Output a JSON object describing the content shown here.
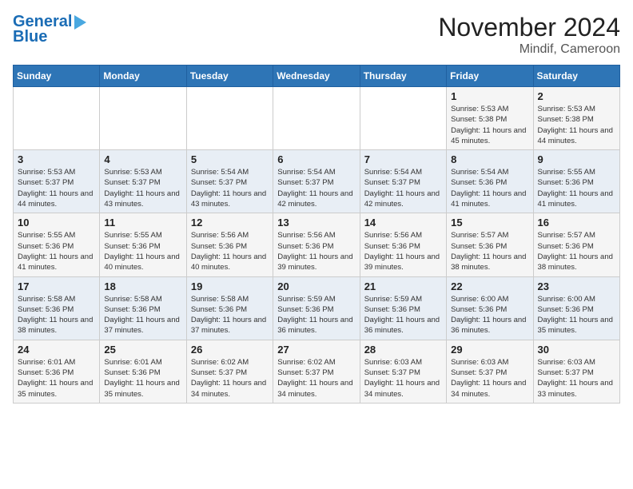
{
  "header": {
    "logo_line1": "General",
    "logo_line2": "Blue",
    "title": "November 2024",
    "subtitle": "Mindif, Cameroon"
  },
  "calendar": {
    "weekdays": [
      "Sunday",
      "Monday",
      "Tuesday",
      "Wednesday",
      "Thursday",
      "Friday",
      "Saturday"
    ],
    "weeks": [
      [
        {
          "day": "",
          "info": ""
        },
        {
          "day": "",
          "info": ""
        },
        {
          "day": "",
          "info": ""
        },
        {
          "day": "",
          "info": ""
        },
        {
          "day": "",
          "info": ""
        },
        {
          "day": "1",
          "info": "Sunrise: 5:53 AM\nSunset: 5:38 PM\nDaylight: 11 hours and 45 minutes."
        },
        {
          "day": "2",
          "info": "Sunrise: 5:53 AM\nSunset: 5:38 PM\nDaylight: 11 hours and 44 minutes."
        }
      ],
      [
        {
          "day": "3",
          "info": "Sunrise: 5:53 AM\nSunset: 5:37 PM\nDaylight: 11 hours and 44 minutes."
        },
        {
          "day": "4",
          "info": "Sunrise: 5:53 AM\nSunset: 5:37 PM\nDaylight: 11 hours and 43 minutes."
        },
        {
          "day": "5",
          "info": "Sunrise: 5:54 AM\nSunset: 5:37 PM\nDaylight: 11 hours and 43 minutes."
        },
        {
          "day": "6",
          "info": "Sunrise: 5:54 AM\nSunset: 5:37 PM\nDaylight: 11 hours and 42 minutes."
        },
        {
          "day": "7",
          "info": "Sunrise: 5:54 AM\nSunset: 5:37 PM\nDaylight: 11 hours and 42 minutes."
        },
        {
          "day": "8",
          "info": "Sunrise: 5:54 AM\nSunset: 5:36 PM\nDaylight: 11 hours and 41 minutes."
        },
        {
          "day": "9",
          "info": "Sunrise: 5:55 AM\nSunset: 5:36 PM\nDaylight: 11 hours and 41 minutes."
        }
      ],
      [
        {
          "day": "10",
          "info": "Sunrise: 5:55 AM\nSunset: 5:36 PM\nDaylight: 11 hours and 41 minutes."
        },
        {
          "day": "11",
          "info": "Sunrise: 5:55 AM\nSunset: 5:36 PM\nDaylight: 11 hours and 40 minutes."
        },
        {
          "day": "12",
          "info": "Sunrise: 5:56 AM\nSunset: 5:36 PM\nDaylight: 11 hours and 40 minutes."
        },
        {
          "day": "13",
          "info": "Sunrise: 5:56 AM\nSunset: 5:36 PM\nDaylight: 11 hours and 39 minutes."
        },
        {
          "day": "14",
          "info": "Sunrise: 5:56 AM\nSunset: 5:36 PM\nDaylight: 11 hours and 39 minutes."
        },
        {
          "day": "15",
          "info": "Sunrise: 5:57 AM\nSunset: 5:36 PM\nDaylight: 11 hours and 38 minutes."
        },
        {
          "day": "16",
          "info": "Sunrise: 5:57 AM\nSunset: 5:36 PM\nDaylight: 11 hours and 38 minutes."
        }
      ],
      [
        {
          "day": "17",
          "info": "Sunrise: 5:58 AM\nSunset: 5:36 PM\nDaylight: 11 hours and 38 minutes."
        },
        {
          "day": "18",
          "info": "Sunrise: 5:58 AM\nSunset: 5:36 PM\nDaylight: 11 hours and 37 minutes."
        },
        {
          "day": "19",
          "info": "Sunrise: 5:58 AM\nSunset: 5:36 PM\nDaylight: 11 hours and 37 minutes."
        },
        {
          "day": "20",
          "info": "Sunrise: 5:59 AM\nSunset: 5:36 PM\nDaylight: 11 hours and 36 minutes."
        },
        {
          "day": "21",
          "info": "Sunrise: 5:59 AM\nSunset: 5:36 PM\nDaylight: 11 hours and 36 minutes."
        },
        {
          "day": "22",
          "info": "Sunrise: 6:00 AM\nSunset: 5:36 PM\nDaylight: 11 hours and 36 minutes."
        },
        {
          "day": "23",
          "info": "Sunrise: 6:00 AM\nSunset: 5:36 PM\nDaylight: 11 hours and 35 minutes."
        }
      ],
      [
        {
          "day": "24",
          "info": "Sunrise: 6:01 AM\nSunset: 5:36 PM\nDaylight: 11 hours and 35 minutes."
        },
        {
          "day": "25",
          "info": "Sunrise: 6:01 AM\nSunset: 5:36 PM\nDaylight: 11 hours and 35 minutes."
        },
        {
          "day": "26",
          "info": "Sunrise: 6:02 AM\nSunset: 5:37 PM\nDaylight: 11 hours and 34 minutes."
        },
        {
          "day": "27",
          "info": "Sunrise: 6:02 AM\nSunset: 5:37 PM\nDaylight: 11 hours and 34 minutes."
        },
        {
          "day": "28",
          "info": "Sunrise: 6:03 AM\nSunset: 5:37 PM\nDaylight: 11 hours and 34 minutes."
        },
        {
          "day": "29",
          "info": "Sunrise: 6:03 AM\nSunset: 5:37 PM\nDaylight: 11 hours and 34 minutes."
        },
        {
          "day": "30",
          "info": "Sunrise: 6:03 AM\nSunset: 5:37 PM\nDaylight: 11 hours and 33 minutes."
        }
      ]
    ]
  }
}
